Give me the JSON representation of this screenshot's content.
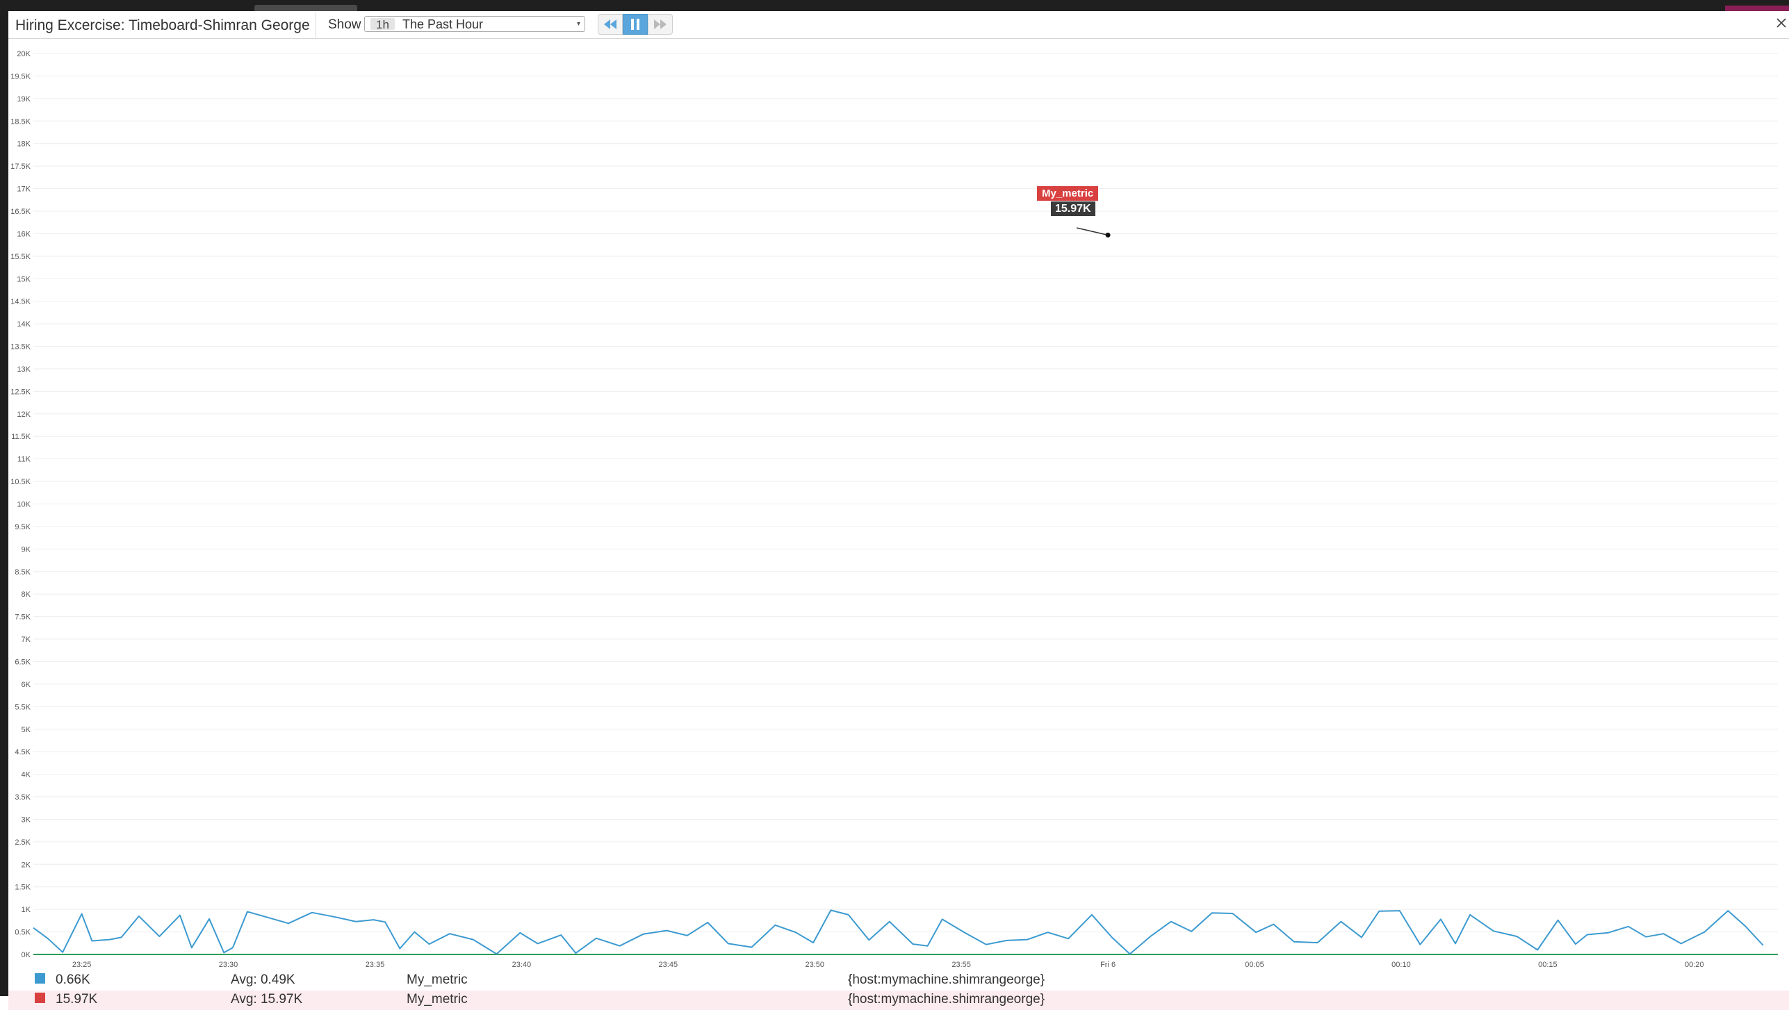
{
  "window": {
    "title": "Hiring Excercise: Timeboard-Shimran George"
  },
  "toolbar": {
    "show_label": "Show",
    "timeframe": {
      "badge": "1h",
      "label": "The Past Hour"
    },
    "buttons": {
      "back_icon": "rewind-icon",
      "pause_icon": "pause-icon",
      "forward_icon": "fast-forward-icon",
      "close_icon": "close-icon"
    }
  },
  "colors": {
    "series_primary": "#3c9ad0",
    "series_secondary": "#d94040",
    "baseline": "#2e9d5a",
    "pause_button": "#5aa6dc",
    "tooltip_name_bg": "#d94040",
    "tooltip_value_bg": "#3a3a3a"
  },
  "chart_data": {
    "type": "line",
    "ylim": [
      0,
      20000
    ],
    "y_ticks": [
      {
        "v": 0,
        "label": "0K"
      },
      {
        "v": 500,
        "label": "0.5K"
      },
      {
        "v": 1000,
        "label": "1K"
      },
      {
        "v": 1500,
        "label": "1.5K"
      },
      {
        "v": 2000,
        "label": "2K"
      },
      {
        "v": 2500,
        "label": "2.5K"
      },
      {
        "v": 3000,
        "label": "3K"
      },
      {
        "v": 3500,
        "label": "3.5K"
      },
      {
        "v": 4000,
        "label": "4K"
      },
      {
        "v": 4500,
        "label": "4.5K"
      },
      {
        "v": 5000,
        "label": "5K"
      },
      {
        "v": 5500,
        "label": "5.5K"
      },
      {
        "v": 6000,
        "label": "6K"
      },
      {
        "v": 6500,
        "label": "6.5K"
      },
      {
        "v": 7000,
        "label": "7K"
      },
      {
        "v": 7500,
        "label": "7.5K"
      },
      {
        "v": 8000,
        "label": "8K"
      },
      {
        "v": 8500,
        "label": "8.5K"
      },
      {
        "v": 9000,
        "label": "9K"
      },
      {
        "v": 9500,
        "label": "9.5K"
      },
      {
        "v": 10000,
        "label": "10K"
      },
      {
        "v": 10500,
        "label": "10.5K"
      },
      {
        "v": 11000,
        "label": "11K"
      },
      {
        "v": 11500,
        "label": "11.5K"
      },
      {
        "v": 12000,
        "label": "12K"
      },
      {
        "v": 12500,
        "label": "12.5K"
      },
      {
        "v": 13000,
        "label": "13K"
      },
      {
        "v": 13500,
        "label": "13.5K"
      },
      {
        "v": 14000,
        "label": "14K"
      },
      {
        "v": 14500,
        "label": "14.5K"
      },
      {
        "v": 15000,
        "label": "15K"
      },
      {
        "v": 15500,
        "label": "15.5K"
      },
      {
        "v": 16000,
        "label": "16K"
      },
      {
        "v": 16500,
        "label": "16.5K"
      },
      {
        "v": 17000,
        "label": "17K"
      },
      {
        "v": 17500,
        "label": "17.5K"
      },
      {
        "v": 18000,
        "label": "18K"
      },
      {
        "v": 18500,
        "label": "18.5K"
      },
      {
        "v": 19000,
        "label": "19K"
      },
      {
        "v": 19500,
        "label": "19.5K"
      },
      {
        "v": 20000,
        "label": "20K"
      }
    ],
    "xlim_minutes": [
      0,
      59.5
    ],
    "x_ticks": [
      {
        "t": 1.65,
        "label": "23:25"
      },
      {
        "t": 6.65,
        "label": "23:30"
      },
      {
        "t": 11.65,
        "label": "23:35"
      },
      {
        "t": 16.65,
        "label": "23:40"
      },
      {
        "t": 21.65,
        "label": "23:45"
      },
      {
        "t": 26.65,
        "label": "23:50"
      },
      {
        "t": 31.65,
        "label": "23:55"
      },
      {
        "t": 36.65,
        "label": "Fri 6"
      },
      {
        "t": 41.65,
        "label": "00:05"
      },
      {
        "t": 46.65,
        "label": "00:10"
      },
      {
        "t": 51.65,
        "label": "00:15"
      },
      {
        "t": 56.65,
        "label": "00:20"
      }
    ],
    "series": [
      {
        "name": "My_metric",
        "color": "#3c9ad0",
        "t": [
          0,
          0.5,
          1,
          1.65,
          2,
          2.6,
          3,
          3.6,
          4.3,
          5,
          5.4,
          6,
          6.5,
          6.8,
          7.3,
          8,
          8.7,
          9.5,
          10.3,
          11,
          11.6,
          12,
          12.5,
          13,
          13.5,
          14.2,
          15,
          15.8,
          16.6,
          17.2,
          18,
          18.5,
          19.2,
          20,
          20.8,
          21.6,
          22.3,
          23,
          23.7,
          24.5,
          25.3,
          26,
          26.6,
          27.2,
          27.8,
          28.5,
          29.2,
          30,
          30.5,
          31,
          31.8,
          32.5,
          33.2,
          33.9,
          34.6,
          35.3,
          36.1,
          36.8,
          37.4,
          38.1,
          38.8,
          39.5,
          40.2,
          40.9,
          41.7,
          42.3,
          43,
          43.8,
          44.6,
          45.3,
          45.9,
          46.6,
          47.3,
          48,
          48.5,
          49,
          49.8,
          50.6,
          51.3,
          52,
          52.6,
          53,
          53.7,
          54.4,
          55,
          55.6,
          56.2,
          57,
          57.8,
          58.4,
          59
        ],
        "v": [
          590,
          350,
          50,
          900,
          300,
          330,
          380,
          850,
          400,
          870,
          150,
          790,
          40,
          150,
          950,
          820,
          690,
          930,
          830,
          730,
          770,
          720,
          130,
          500,
          230,
          460,
          330,
          10,
          480,
          240,
          430,
          30,
          360,
          190,
          450,
          530,
          420,
          710,
          240,
          160,
          650,
          490,
          260,
          980,
          880,
          320,
          730,
          230,
          190,
          780,
          470,
          220,
          310,
          330,
          490,
          350,
          880,
          370,
          10,
          400,
          730,
          510,
          920,
          910,
          490,
          670,
          280,
          260,
          730,
          380,
          960,
          970,
          220,
          780,
          240,
          880,
          520,
          400,
          100,
          760,
          230,
          440,
          480,
          620,
          390,
          460,
          240,
          500,
          970,
          620,
          200
        ]
      }
    ],
    "baseline_value": 0,
    "baseline_end_minute": 59.5,
    "highlight_point": {
      "series": "My_metric",
      "t": 36.65,
      "value": 15970
    }
  },
  "tooltip": {
    "name": "My_metric",
    "value": "15.97K"
  },
  "legend": [
    {
      "value": "0.66K",
      "avg": "Avg: 0.49K",
      "name": "My_metric",
      "scope": "{host:mymachine.shimrangeorge}",
      "color": "#3c9ad0"
    },
    {
      "value": "15.97K",
      "avg": "Avg: 15.97K",
      "name": "My_metric",
      "scope": "{host:mymachine.shimrangeorge}",
      "color": "#d94040"
    }
  ]
}
